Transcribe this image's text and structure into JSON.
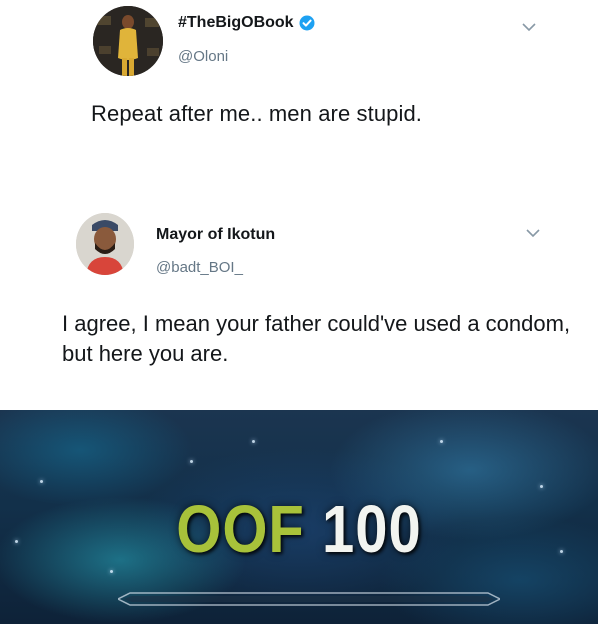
{
  "tweet1": {
    "display_name": "#TheBigOBook",
    "handle": "@Oloni",
    "text": "Repeat after me.. men are stupid.",
    "verified": true,
    "colors": {
      "verified": "#1da1f2"
    }
  },
  "tweet2": {
    "display_name": "Mayor of Ikotun",
    "handle": "@badt_BOI_",
    "text": "I agree, I mean your father could've used a condom, but here you are."
  },
  "banner": {
    "word": "OOF",
    "number": "100",
    "colors": {
      "word": "#a8c23a",
      "number": "#f2f4f0"
    }
  },
  "icons": {
    "verified": "verified-badge-icon",
    "chevron": "chevron-down-icon"
  }
}
